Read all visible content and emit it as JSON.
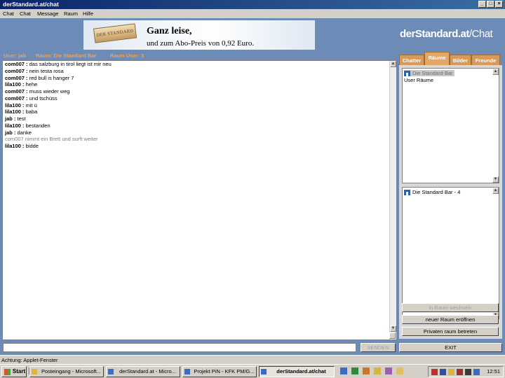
{
  "window": {
    "title": "derStandard.at/chat",
    "controls": [
      "_",
      "□",
      "×"
    ]
  },
  "menu": [
    "Chat",
    "Chat",
    "Message",
    "Raum",
    "Hilfe"
  ],
  "ad": {
    "logo_text": "DER STANDARD",
    "headline": "Ganz leise,",
    "subline": "und zum Abo-Preis von 0,92 Euro."
  },
  "brand": {
    "bold": "derStandard.at",
    "light": "/Chat"
  },
  "info": {
    "user": "User: jab",
    "room": "Raum: Die Standard Bar",
    "count": "Raum User: 3"
  },
  "messages": [
    {
      "nick": "com007 :",
      "text": " das salzburg in tirol liegt ist mir neu"
    },
    {
      "nick": "com007 :",
      "text": " nein testa rosa"
    },
    {
      "nick": "com007 :",
      "text": " red bull is hanger 7"
    },
    {
      "nick": "lila100 :",
      "text": " hehe"
    },
    {
      "nick": "com007 :",
      "text": " muss wieder weg"
    },
    {
      "nick": "com007 :",
      "text": " und tschüss"
    },
    {
      "nick": "lila100 :",
      "text": " mit ü"
    },
    {
      "nick": "lila100 :",
      "text": " baba"
    },
    {
      "nick": "jab :",
      "text": " test"
    },
    {
      "nick": "lila100 :",
      "text": " bestanden"
    },
    {
      "nick": "jab :",
      "text": " danke"
    },
    {
      "nick": "",
      "text": "com007 nimmt ein Brett und surft weiter",
      "system": true
    },
    {
      "nick": "lila100 :",
      "text": " bidde"
    }
  ],
  "input": {
    "value": ""
  },
  "buttons": {
    "send": "SENDEN",
    "change_room": "in Raum wechseln",
    "new_room": "neuer Raum eröffnen",
    "private_room": "Privaten raum betreten",
    "exit": "EXIT"
  },
  "tabs": [
    "Chatter",
    "Räume",
    "Bilder",
    "Freunde"
  ],
  "active_tab": "Räume",
  "rooms": {
    "selected": "Die Standard Bar",
    "category": "User Räume"
  },
  "room_detail": "Die Standard Bar - 4",
  "status": "Achtung: Applet-Fenster",
  "taskbar": {
    "start": "Start",
    "items": [
      "Posteingang - Microsoft...",
      "derStandard.at - Micro...",
      "Projekt PiN - KFK PM/G...",
      "derStandard.at/chat"
    ],
    "active_item": "derStandard.at/chat",
    "clock": "12:51"
  },
  "colors": {
    "accent": "#e3a867",
    "app_bg": "#6d8bb7",
    "titlebar": "#0a246a",
    "info": "#f5a14a"
  }
}
